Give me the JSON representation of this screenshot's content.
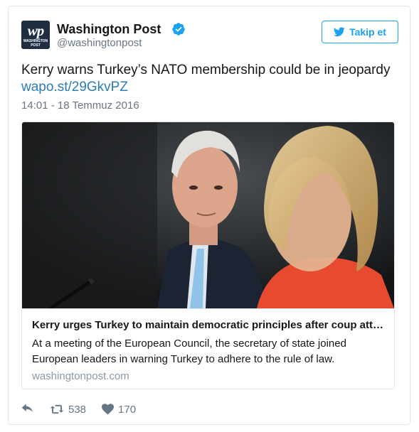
{
  "account": {
    "name": "Washington Post",
    "handle": "@washingtonpost",
    "avatar_text": "wp",
    "avatar_subtext_1": "WASHINGTON",
    "avatar_subtext_2": "POST",
    "verified_icon": "verified-badge-icon"
  },
  "follow_button": {
    "label": "Takip et",
    "icon": "twitter-bird-icon"
  },
  "tweet": {
    "text": "Kerry warns Turkey’s NATO membership could be in jeopardy",
    "link": "wapo.st/29GkvPZ",
    "timestamp": "14:01 - 18 Temmuz 2016"
  },
  "card": {
    "title": "Kerry urges Turkey to maintain democratic principles after coup attempt",
    "description": "At a meeting of the European Council, the secretary of state joined European leaders in warning Turkey to adhere to the rule of law.",
    "domain": "washingtonpost.com"
  },
  "actions": {
    "reply_icon": "reply-icon",
    "retweet_icon": "retweet-icon",
    "retweet_count": "538",
    "like_icon": "heart-icon",
    "like_count": "170"
  },
  "colors": {
    "accent": "#1da1f2",
    "link": "#2b7bb9",
    "muted": "#657786"
  }
}
